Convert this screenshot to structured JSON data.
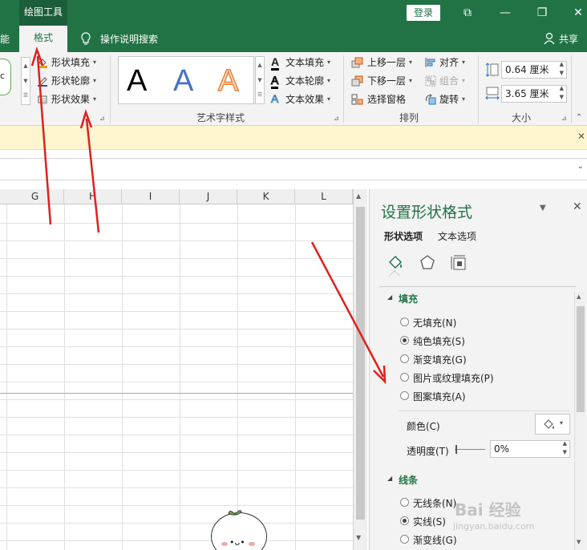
{
  "titlebar": {
    "context_tab": "绘图工具",
    "login_label": "登录",
    "controls": [
      "⧉",
      "—",
      "❐",
      "✕"
    ]
  },
  "tabs": {
    "partial_left": "能",
    "format": "格式",
    "search": "操作说明搜索",
    "share": "共享"
  },
  "ribbon": {
    "shape_style_items": [
      "形状填充",
      "形状轮廓",
      "形状效果"
    ],
    "preview_letter": "c",
    "wordart_label": "艺术字样式",
    "wordart_letters": [
      "A",
      "A",
      "A"
    ],
    "wordart_items": [
      "文本填充",
      "文本轮廓",
      "文本效果"
    ],
    "arrange_label": "排列",
    "arrange_items": [
      "上移一层",
      "下移一层",
      "选择窗格"
    ],
    "arrange_right": [
      "对齐",
      "组合",
      "旋转"
    ],
    "size_label": "大小",
    "height_value": "0.64 厘米",
    "width_value": "3.65 厘米"
  },
  "sheet": {
    "columns": [
      "G",
      "H",
      "I",
      "J",
      "K",
      "L"
    ]
  },
  "panel": {
    "title": "设置形状格式",
    "tab_shape": "形状选项",
    "tab_text": "文本选项",
    "fill_section": "填充",
    "fill_options": [
      {
        "label": "无填充(N)",
        "selected": false
      },
      {
        "label": "纯色填充(S)",
        "selected": true
      },
      {
        "label": "渐变填充(G)",
        "selected": false
      },
      {
        "label": "图片或纹理填充(P)",
        "selected": false
      },
      {
        "label": "图案填充(A)",
        "selected": false
      }
    ],
    "color_label": "颜色(C)",
    "transparency_label": "透明度(T)",
    "transparency_value": "0%",
    "line_section": "线条",
    "line_options": [
      {
        "label": "无线条(N)",
        "selected": false
      },
      {
        "label": "实线(S)",
        "selected": true
      },
      {
        "label": "渐变线(G)",
        "selected": false
      }
    ]
  },
  "watermark": {
    "text": "Bai 经验",
    "url": "jingyan.baidu.com"
  },
  "colors": {
    "excel_green": "#217346",
    "annotation_red": "#e0201c"
  }
}
